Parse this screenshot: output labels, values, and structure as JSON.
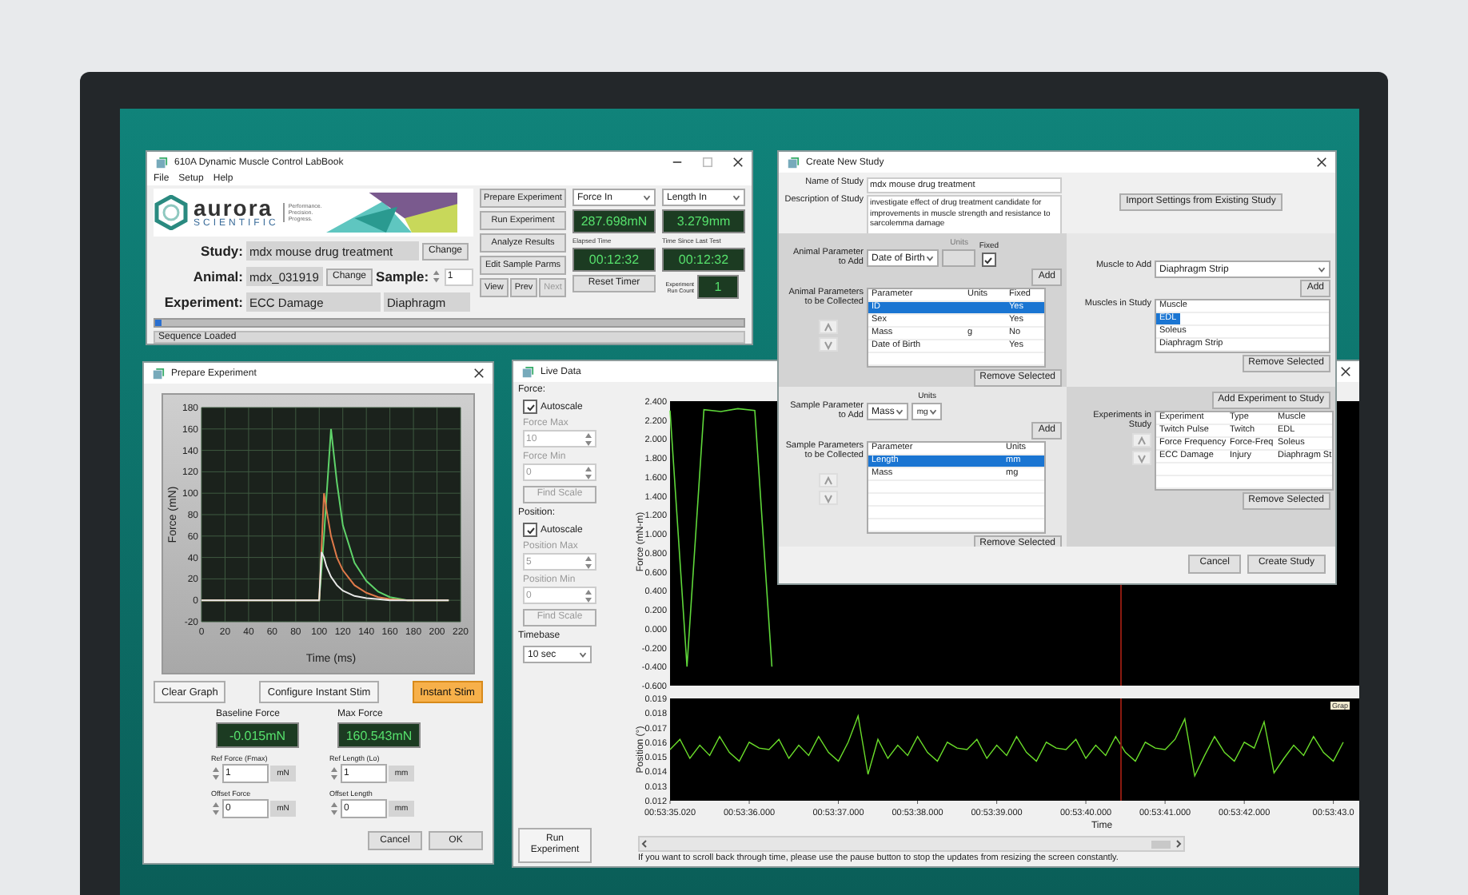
{
  "labbook": {
    "title": "610A Dynamic Muscle Control LabBook",
    "menu": [
      "File",
      "Setup",
      "Help"
    ],
    "logo": {
      "name": "aurora",
      "sub": "SCIENTIFIC",
      "tagline": [
        "Performance.",
        "Precision.",
        "Progress."
      ]
    },
    "study": {
      "label": "Study:",
      "value": "mdx mouse drug treatment",
      "button": "Change"
    },
    "animal": {
      "label": "Animal:",
      "value": "mdx_031919",
      "button": "Change"
    },
    "sample": {
      "label": "Sample:",
      "value": "1"
    },
    "experiment": {
      "label": "Experiment:",
      "value": "ECC Damage",
      "muscle": "Diaphragm"
    },
    "actions": [
      "Prepare Experiment",
      "Run Experiment",
      "Analyze Results",
      "Edit Sample Parms"
    ],
    "nav": [
      {
        "label": "View",
        "disabled": false
      },
      {
        "label": "Prev",
        "disabled": false
      },
      {
        "label": "Next",
        "disabled": true
      }
    ],
    "force_select": "Force In",
    "force_reading": "287.698mN",
    "length_select": "Length In",
    "length_reading": "3.279mm",
    "elapsed_label": "Elapsed Time",
    "elapsed": "00:12:32",
    "since_label": "Time Since Last Test",
    "since": "00:12:32",
    "reset": "Reset Timer",
    "run_count_label": "Experiment Run Count",
    "run_count": "1",
    "progress": {
      "level": 0.01
    },
    "status": "Sequence Loaded"
  },
  "prepare": {
    "title": "Prepare Experiment",
    "chart_data": {
      "type": "line",
      "xlabel": "Time (ms)",
      "ylabel": "Force (mN)",
      "x": [
        0,
        100,
        102,
        104,
        106,
        110,
        115,
        120,
        130,
        140,
        150,
        160,
        175,
        210
      ],
      "series": [
        {
          "color": "#5fd36a",
          "values": [
            0,
            0,
            30,
            60,
            95,
            160,
            110,
            70,
            35,
            18,
            8,
            3,
            0,
            0
          ]
        },
        {
          "color": "#e07a4a",
          "values": [
            0,
            0,
            50,
            100,
            85,
            60,
            40,
            28,
            14,
            7,
            3,
            1,
            0,
            0
          ]
        },
        {
          "color": "#e8e8e8",
          "values": [
            0,
            0,
            45,
            40,
            32,
            22,
            14,
            9,
            4,
            2,
            1,
            0,
            0,
            0
          ]
        }
      ],
      "xlim": [
        0,
        220
      ],
      "ylim": [
        -20,
        180
      ],
      "xticks": [
        0,
        20,
        40,
        60,
        80,
        100,
        120,
        140,
        160,
        180,
        200,
        220
      ],
      "yticks": [
        -20,
        0,
        20,
        40,
        60,
        80,
        100,
        120,
        140,
        160,
        180
      ],
      "grid": true
    },
    "buttons": [
      {
        "label": "Clear Graph",
        "kind": "normal"
      },
      {
        "label": "Configure Instant Stim",
        "kind": "normal"
      },
      {
        "label": "Instant Stim",
        "kind": "highlight"
      }
    ],
    "readouts": [
      {
        "label": "Baseline Force",
        "value": "-0.015mN"
      },
      {
        "label": "Max Force",
        "value": "160.543mN"
      }
    ],
    "inputs": [
      {
        "label": "Ref Force (Fmax)",
        "value": "1",
        "unit": "mN"
      },
      {
        "label": "Ref Length (Lo)",
        "value": "1",
        "unit": "mm"
      },
      {
        "label": "Offset Force",
        "value": "0",
        "unit": "mN"
      },
      {
        "label": "Offset Length",
        "value": "0",
        "unit": "mm"
      }
    ],
    "footer": [
      "Cancel",
      "OK"
    ]
  },
  "live_data": {
    "title": "Live Data",
    "groups": [
      {
        "heading": "Force:",
        "autoscale": {
          "label": "Autoscale",
          "checked": true
        },
        "fields": [
          {
            "label": "Force Max",
            "value": "10",
            "disabled": true
          },
          {
            "label": "Force Min",
            "value": "0",
            "disabled": true
          }
        ],
        "find_scale": {
          "label": "Find Scale",
          "disabled": true
        }
      },
      {
        "heading": "Position:",
        "autoscale": {
          "label": "Autoscale",
          "checked": true
        },
        "fields": [
          {
            "label": "Position Max",
            "value": "5",
            "disabled": true
          },
          {
            "label": "Position Min",
            "value": "0",
            "disabled": true
          }
        ],
        "find_scale": {
          "label": "Find Scale",
          "disabled": true
        }
      }
    ],
    "timebase": {
      "label": "Timebase",
      "value": "10 sec"
    },
    "force_chart": {
      "chart_data": {
        "type": "line",
        "ylabel": "Force (mN-m)",
        "categories": [
          null,
          null,
          null,
          null,
          null,
          null,
          null
        ],
        "series": [
          {
            "color": "#5fd83a",
            "values": [
              2.3,
              -0.4,
              2.31,
              2.29,
              2.32,
              2.3,
              -0.4
            ]
          }
        ],
        "ylim": [
          -0.6,
          2.4
        ],
        "yticks": [
          {
            "value": 2.4,
            "label": "2.400"
          },
          {
            "value": 2.2,
            "label": "2.200"
          },
          {
            "value": 2.0,
            "label": "2.000"
          },
          {
            "value": 1.8,
            "label": "1.800"
          },
          {
            "value": 1.6,
            "label": "1.600"
          },
          {
            "value": 1.4,
            "label": "1.400"
          },
          {
            "value": 1.2,
            "label": "1.200"
          },
          {
            "value": 1.0,
            "label": "1.000"
          },
          {
            "value": 0.8,
            "label": "0.800"
          },
          {
            "value": 0.6,
            "label": "0.600"
          },
          {
            "value": 0.4,
            "label": "0.400"
          },
          {
            "value": 0.2,
            "label": "0.200"
          },
          {
            "value": 0,
            "label": "0.000"
          },
          {
            "value": -0.2,
            "label": "-0.200"
          },
          {
            "value": -0.4,
            "label": "-0.400"
          },
          {
            "value": -0.6,
            "label": "-0.600"
          }
        ]
      }
    },
    "position_chart": {
      "tag": "Grap",
      "chart_data": {
        "type": "line",
        "xlabel": "Time",
        "ylabel": "Position (°)",
        "categories": [
          "00:53:35.020",
          null,
          null,
          null,
          null,
          null,
          null,
          null,
          "00:53:36.000",
          null,
          null,
          null,
          null,
          null,
          null,
          null,
          null,
          "00:53:37.000",
          null,
          null,
          null,
          null,
          null,
          null,
          null,
          "00:53:38.000",
          null,
          null,
          null,
          null,
          null,
          null,
          null,
          "00:53:39.000",
          null,
          null,
          null,
          null,
          null,
          null,
          null,
          null,
          "00:53:40.000",
          null,
          null,
          null,
          null,
          null,
          null,
          null,
          "00:53:41.000",
          null,
          null,
          null,
          null,
          null,
          null,
          null,
          "00:53:42.000",
          null,
          null,
          null,
          null,
          null,
          null,
          null,
          null,
          "00:53:43.0",
          null
        ],
        "series": [
          {
            "color": "#6add2a",
            "values": [
              0.0155,
              0.0162,
              0.0149,
              0.0158,
              0.0151,
              0.0164,
              0.0153,
              0.0147,
              0.016,
              0.0156,
              0.0155,
              0.0162,
              0.0149,
              0.0158,
              0.0151,
              0.0164,
              0.0153,
              0.0147,
              0.016,
              0.0178,
              0.0138,
              0.0162,
              0.0149,
              0.0158,
              0.0151,
              0.0164,
              0.0153,
              0.0147,
              0.016,
              0.0156,
              0.0155,
              0.0162,
              0.0149,
              0.0158,
              0.0151,
              0.0164,
              0.0153,
              0.0147,
              0.016,
              0.0156,
              0.0155,
              0.0162,
              0.0149,
              0.0158,
              0.0151,
              0.0164,
              0.0153,
              0.0147,
              0.016,
              0.0156,
              0.0155,
              0.0162,
              0.0176,
              0.0137,
              0.0151,
              0.0164,
              0.0153,
              0.0147,
              0.016,
              0.0156,
              0.0174,
              0.0139,
              0.0149,
              0.0158,
              0.0151,
              0.0164,
              0.0153,
              0.0147,
              0.016
            ]
          }
        ],
        "ylim": [
          0.012,
          0.019
        ],
        "yticks": [
          {
            "value": 0.019,
            "label": "0.019"
          },
          {
            "value": 0.018,
            "label": "0.018"
          },
          {
            "value": 0.017,
            "label": "0.017"
          },
          {
            "value": 0.016,
            "label": "0.016"
          },
          {
            "value": 0.015,
            "label": "0.015"
          },
          {
            "value": 0.014,
            "label": "0.014"
          },
          {
            "value": 0.013,
            "label": "0.013"
          },
          {
            "value": 0.012,
            "label": "0.012"
          }
        ]
      }
    },
    "run_button": "Run Experiment",
    "hint": "If you want to scroll back through time, please use the pause button to stop the updates from resizing the screen constantly."
  },
  "create_study": {
    "title": "Create New Study",
    "name": {
      "label": "Name of Study",
      "value": "mdx mouse drug treatment"
    },
    "description": {
      "label": "Description of Study",
      "value": "investigate effect of drug treatment candidate for improvements in muscle strength and resistance to sarcolemma damage"
    },
    "import_button": "Import Settings from Existing Study",
    "animal_add": {
      "label": "Animal Parameter to Add",
      "value": "Date of Birth",
      "units": {
        "label": "Units",
        "disabled": true
      },
      "fixed": {
        "label": "Fixed",
        "checked": true
      },
      "button": "Add"
    },
    "animal_table": {
      "label": "Animal Parameters to be Collected",
      "columns": [
        "Parameter",
        "Units",
        "Fixed"
      ],
      "rows": [
        {
          "parameter": "ID",
          "fixed": "Yes",
          "selected": true
        },
        {
          "parameter": "Sex",
          "fixed": "Yes",
          "selected": false
        },
        {
          "parameter": "Mass",
          "units": "g",
          "fixed": "No",
          "selected": false
        },
        {
          "parameter": "Date of Birth",
          "fixed": "Yes",
          "selected": false
        }
      ],
      "remove": "Remove Selected"
    },
    "muscle_add": {
      "label": "Muscle to Add",
      "value": "Diaphragm Strip",
      "button": "Add"
    },
    "muscles": {
      "label": "Muscles in Study",
      "header": "Muscle",
      "items": [
        {
          "label": "EDL",
          "selected": true
        },
        {
          "label": "Soleus",
          "selected": false
        },
        {
          "label": "Diaphragm Strip",
          "selected": false
        }
      ],
      "remove": "Remove Selected"
    },
    "sample_add": {
      "label": "Sample Parameter to Add",
      "value": "Mass",
      "units_label": "Units",
      "units": "mg",
      "button": "Add"
    },
    "sample_table": {
      "label": "Sample Parameters to be Collected",
      "columns": [
        "Parameter",
        "Units"
      ],
      "rows": [
        {
          "parameter": "Length",
          "units": "mm",
          "selected": true
        },
        {
          "parameter": "Mass",
          "units": "mg",
          "selected": false
        }
      ],
      "remove": "Remove Selected"
    },
    "experiments": {
      "add_button": "Add Experiment to Study",
      "label": "Experiments in Study",
      "columns": [
        "Experiment",
        "Type",
        "Muscle"
      ],
      "rows": [
        {
          "experiment": "Twitch Pulse",
          "type": "Twitch",
          "muscle": "EDL",
          "selected": false
        },
        {
          "experiment": "Force Frequency",
          "type": "Force-Freq",
          "muscle": "Soleus",
          "selected": false
        },
        {
          "experiment": "ECC Damage",
          "type": "Injury",
          "muscle": "Diaphragm St",
          "selected": false
        }
      ],
      "remove": "Remove Selected"
    },
    "footer": [
      "Cancel",
      "Create Study"
    ]
  }
}
